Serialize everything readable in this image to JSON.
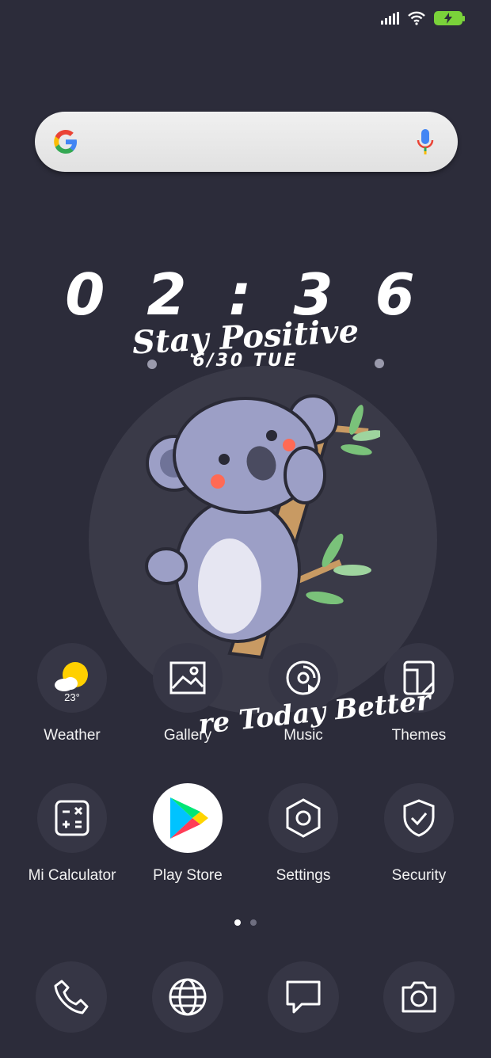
{
  "clock": {
    "time": "0 2 : 3 6",
    "date": "6/30 TUE"
  },
  "wallpaper": {
    "tagline": "Stay Positive",
    "bottom_text": "re Today Better"
  },
  "apps_row1": [
    {
      "label": "Weather",
      "icon": "weather-icon",
      "temp": "23°"
    },
    {
      "label": "Gallery",
      "icon": "gallery-icon"
    },
    {
      "label": "Music",
      "icon": "music-icon"
    },
    {
      "label": "Themes",
      "icon": "themes-icon"
    }
  ],
  "apps_row2": [
    {
      "label": "Mi Calculator",
      "icon": "calculator-icon"
    },
    {
      "label": "Play Store",
      "icon": "play-store-icon"
    },
    {
      "label": "Settings",
      "icon": "settings-icon"
    },
    {
      "label": "Security",
      "icon": "security-icon"
    }
  ],
  "dock": [
    {
      "icon": "phone-icon"
    },
    {
      "icon": "browser-icon"
    },
    {
      "icon": "messages-icon"
    },
    {
      "icon": "camera-icon"
    }
  ],
  "pages": {
    "total": 2,
    "current": 1
  },
  "colors": {
    "background": "#2c2c3a",
    "battery": "#7ad23a",
    "bubble": "#363645"
  }
}
